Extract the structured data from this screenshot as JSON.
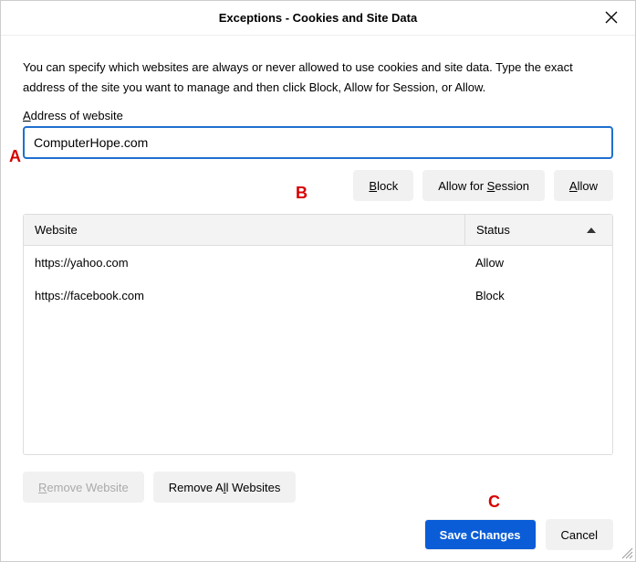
{
  "title": "Exceptions - Cookies and Site Data",
  "description": "You can specify which websites are always or never allowed to use cookies and site data. Type the exact address of the site you want to manage and then click Block, Allow for Session, or Allow.",
  "address": {
    "label_pre": "A",
    "label_rest": "ddress of website",
    "value": "ComputerHope.com"
  },
  "action_buttons": {
    "block": {
      "u": "B",
      "rest": "lock"
    },
    "allow_session": {
      "pre": "Allow for ",
      "u": "S",
      "rest": "ession"
    },
    "allow": {
      "u": "A",
      "rest": "llow"
    }
  },
  "table": {
    "header_website": "Website",
    "header_status": "Status",
    "rows": [
      {
        "website": "https://yahoo.com",
        "status": "Allow"
      },
      {
        "website": "https://facebook.com",
        "status": "Block"
      }
    ]
  },
  "remove_buttons": {
    "remove_one": {
      "u": "R",
      "rest": "emove Website"
    },
    "remove_all": {
      "pre": "Remove A",
      "u": "l",
      "rest": "l Websites"
    }
  },
  "footer": {
    "save": "Save Changes",
    "cancel": "Cancel"
  },
  "callouts": {
    "a": "A",
    "b": "B",
    "c": "C"
  }
}
